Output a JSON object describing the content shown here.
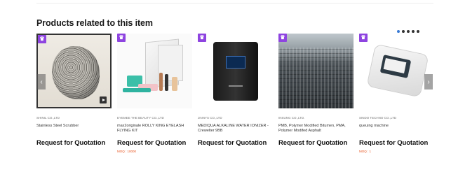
{
  "section": {
    "title": "Products related to this item"
  },
  "pager": {
    "dots": 5,
    "active_index": 0
  },
  "carousel": {
    "prev_label": "‹",
    "next_label": "›",
    "items": [
      {
        "company": "SHINIL CO.,LTD",
        "name": "Stainless Steel Scrubber",
        "cta": "Request for Quotation",
        "moq": "",
        "badge": "♛",
        "image": "scrubber",
        "has_video": true
      },
      {
        "company": "EYEMEE THE BEAUTY CO.,LTD",
        "name": "max2originale ROLLY KING EYELASH FLYING KIT",
        "cta": "Request for Quotation",
        "moq": "MOQ : 10000",
        "badge": "♛",
        "image": "eyelash-kit",
        "has_video": false
      },
      {
        "company": "JINNYS CO.,LTD",
        "name": "MEDIQUA ALKALINE WATER IONIZER - Crewelter 9BB",
        "cta": "Request for Quotation",
        "moq": "",
        "badge": "♛",
        "image": "water-ionizer",
        "has_video": false
      },
      {
        "company": "INSUNG CO.,LTD.",
        "name": "PMB, Polymer Modified Bitumen, PMA, Polymer Modifed Asphalt",
        "cta": "Request for Quotation",
        "moq": "",
        "badge": "♛",
        "image": "bitumen-drums",
        "has_video": false
      },
      {
        "company": "SINDO TECHNO CO.,LTD",
        "name": "queuing machine",
        "cta": "Request for Quotation",
        "moq": "MOQ : 1",
        "badge": "♛",
        "image": "queuing-machine",
        "has_video": false
      }
    ]
  },
  "colors": {
    "badge": "#8e44e0",
    "moq": "#e8541f",
    "pager_active": "#3a7bd5"
  }
}
